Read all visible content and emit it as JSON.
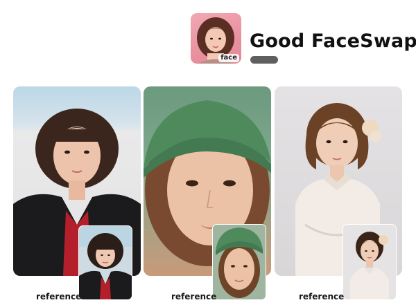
{
  "header": {
    "title": "Good FaceSwap",
    "face_label": "face"
  },
  "cards": [
    {
      "reference_label": "reference"
    },
    {
      "reference_label": "reference"
    },
    {
      "reference_label": "reference"
    }
  ],
  "colors": {
    "face_thumb_bg": "#e9919f",
    "title_text": "#111111",
    "title_bar": "#5f5f5f",
    "hat_green": "#4f8a5d"
  }
}
